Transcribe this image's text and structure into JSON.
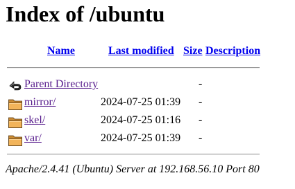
{
  "page": {
    "heading": "Index of /ubuntu"
  },
  "columns": {
    "name": "Name",
    "last_modified": "Last modified",
    "size": "Size",
    "description": "Description"
  },
  "rows": [
    {
      "icon": "back-icon",
      "name": "Parent Directory",
      "modified": "",
      "size": "-"
    },
    {
      "icon": "folder-icon",
      "name": "mirror/",
      "modified": "2024-07-25 01:39",
      "size": "-"
    },
    {
      "icon": "folder-icon",
      "name": "skel/",
      "modified": "2024-07-25 01:16",
      "size": "-"
    },
    {
      "icon": "folder-icon",
      "name": "var/",
      "modified": "2024-07-25 01:39",
      "size": "-"
    }
  ],
  "footer": {
    "server_signature": "Apache/2.4.41 (Ubuntu) Server at 192.168.56.10 Port 80"
  },
  "colors": {
    "link": "#0000ee",
    "visited_link": "#551a8b",
    "folder": "#e8a54a",
    "rule": "#9a9a9a"
  }
}
